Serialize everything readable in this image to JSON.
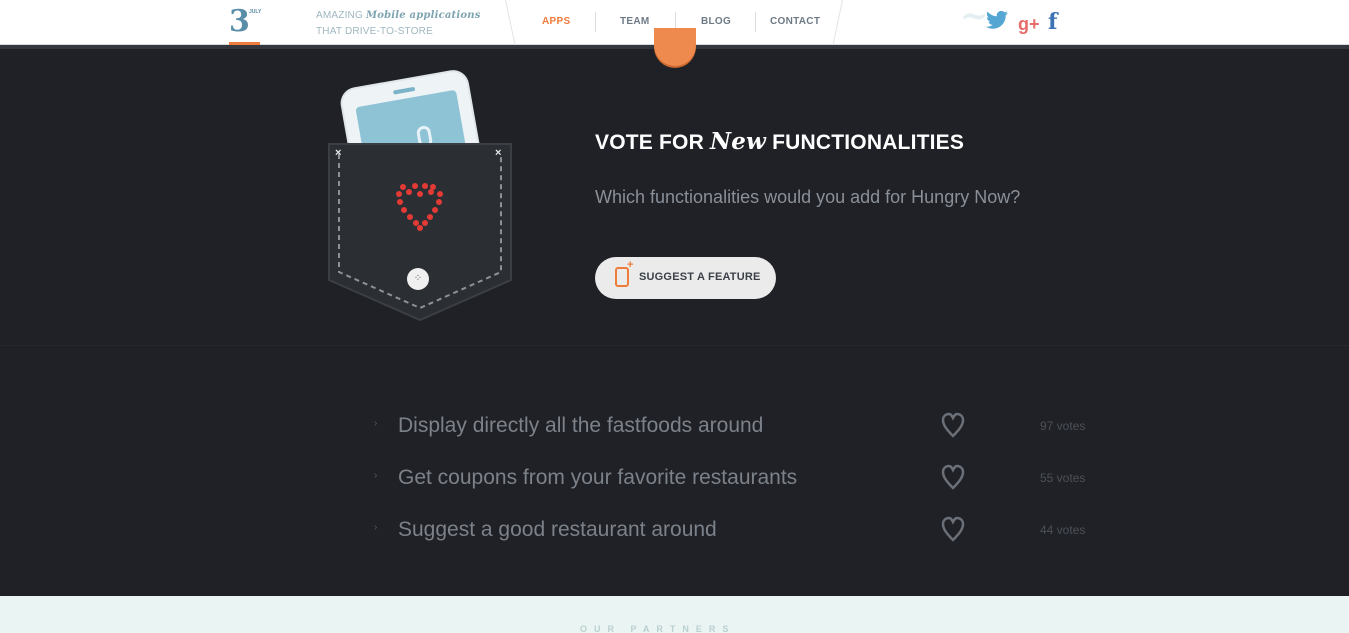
{
  "header": {
    "logo_number": "3",
    "logo_sup": "JULY",
    "tagline_line1_prefix": "AMAZING",
    "tagline_line1_script": "Mobile applications",
    "tagline_line2": "THAT DRIVE-TO-STORE",
    "nav": [
      {
        "label": "APPS",
        "active": true
      },
      {
        "label": "TEAM",
        "active": false
      },
      {
        "label": "BLOG",
        "active": false
      },
      {
        "label": "CONTACT",
        "active": false
      }
    ],
    "social": [
      {
        "icon": "twitter-icon",
        "glyph": "🐦"
      },
      {
        "icon": "google-plus-icon",
        "glyph": "g+"
      },
      {
        "icon": "facebook-icon",
        "glyph": "f"
      }
    ]
  },
  "hero": {
    "title_prefix": "VOTE FOR",
    "title_script": "New",
    "title_suffix": "FUNCTIONALITIES",
    "subtitle": "Which functionalities would you add for Hungry Now?",
    "button_label": "SUGGEST A FEATURE"
  },
  "functionalities": [
    {
      "text": "Display directly all the fastfoods around",
      "votes": "97 votes"
    },
    {
      "text": "Get coupons from your favorite restaurants",
      "votes": "55 votes"
    },
    {
      "text": "Suggest a good restaurant around",
      "votes": "44 votes"
    }
  ],
  "footer": {
    "partners_label": "OUR PARTNERS"
  },
  "colors": {
    "accent": "#ef7c3b",
    "dark_bg": "#1f2126",
    "partners_bg": "#eaf5f3",
    "heart_red": "#d9302c"
  }
}
